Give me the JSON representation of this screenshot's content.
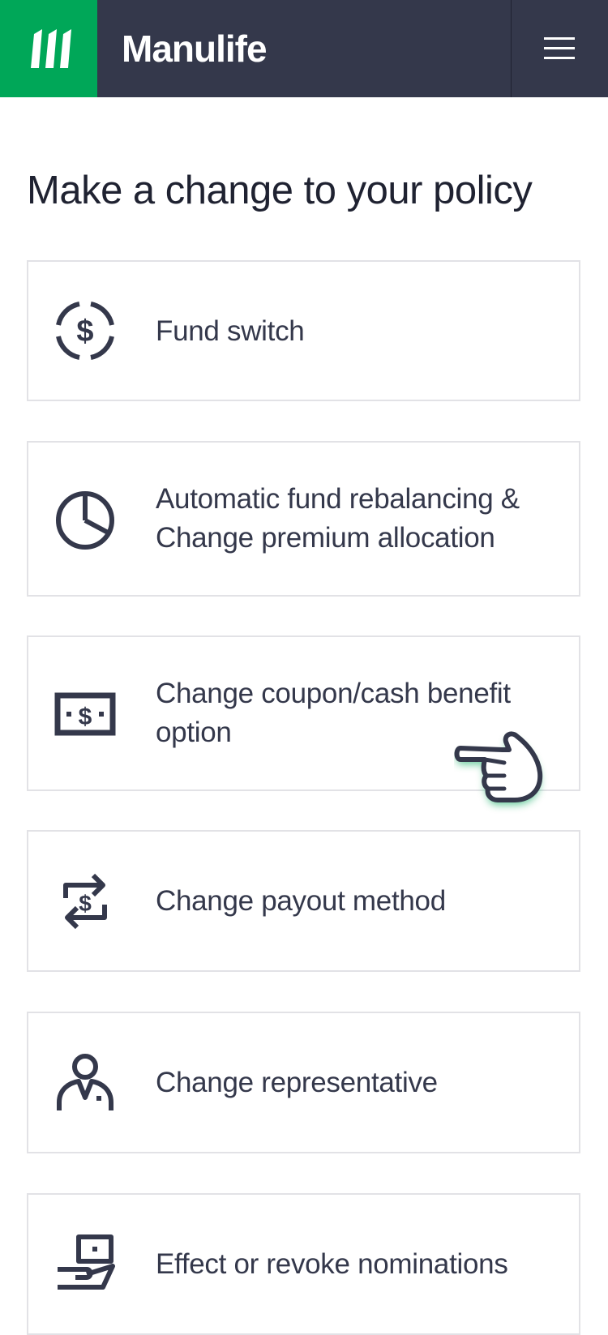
{
  "header": {
    "brand": "Manulife",
    "logo_icon": "manulife-stripes-icon",
    "menu_icon": "hamburger-menu-icon",
    "brand_color": "#00a758",
    "bar_color": "#34384b"
  },
  "page": {
    "title": "Make a change to your policy"
  },
  "options": [
    {
      "icon": "dollar-cycle-icon",
      "label": "Fund switch"
    },
    {
      "icon": "pie-chart-icon",
      "label": "Automatic fund rebalancing & Change premium allocation"
    },
    {
      "icon": "banknote-icon",
      "label": "Change coupon/cash benefit option"
    },
    {
      "icon": "dollar-exchange-icon",
      "label": "Change payout method"
    },
    {
      "icon": "person-representative-icon",
      "label": "Change representative"
    },
    {
      "icon": "hand-receiving-card-icon",
      "label": "Effect or revoke nominations"
    }
  ],
  "cursor": {
    "icon": "pointing-hand-cursor-icon"
  }
}
